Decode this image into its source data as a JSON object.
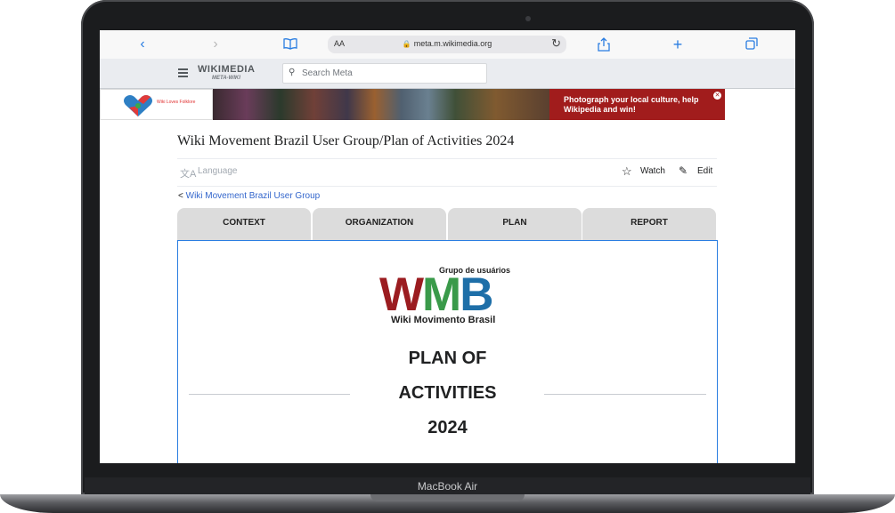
{
  "device": {
    "label": "MacBook Air"
  },
  "browser": {
    "address_text": "meta.m.wikimedia.org",
    "aa_label": "AA",
    "icons": [
      "back-icon",
      "forward-icon",
      "bookmarks-icon",
      "lock-icon",
      "reload-icon",
      "share-icon",
      "new-tab-icon",
      "tabs-icon"
    ]
  },
  "wiki": {
    "logo_text": "WIKIMEDIA",
    "logo_sub": "META-WIKI",
    "search_placeholder": "Search Meta"
  },
  "banner": {
    "logo_text": "Wiki Loves Folklore",
    "cta_text": "Photograph your local culture, help Wikipedia and win!",
    "colors": {
      "cta_background": "#a11c1c"
    }
  },
  "page": {
    "title": "Wiki Movement Brazil User Group/Plan of Activities 2024",
    "language_label": "Language",
    "watch_label": "Watch",
    "edit_label": "Edit",
    "breadcrumb_prefix": "<",
    "breadcrumb_link": "Wiki Movement Brazil User Group",
    "tabs": [
      {
        "label": "CONTEXT"
      },
      {
        "label": "ORGANIZATION"
      },
      {
        "label": "PLAN"
      },
      {
        "label": "REPORT"
      }
    ]
  },
  "content": {
    "logo_top": "Grupo de usuários",
    "logo_letters": {
      "w": "W",
      "m": "M",
      "b": "B"
    },
    "logo_name": "Wiki Movimento Brasil",
    "heading_lines": [
      "PLAN OF",
      "ACTIVITIES",
      "2024"
    ],
    "colors": {
      "w": "#9b1c20",
      "m": "#3a9a4a",
      "b": "#1e6fa8",
      "active_border": "#2a7de1"
    }
  }
}
